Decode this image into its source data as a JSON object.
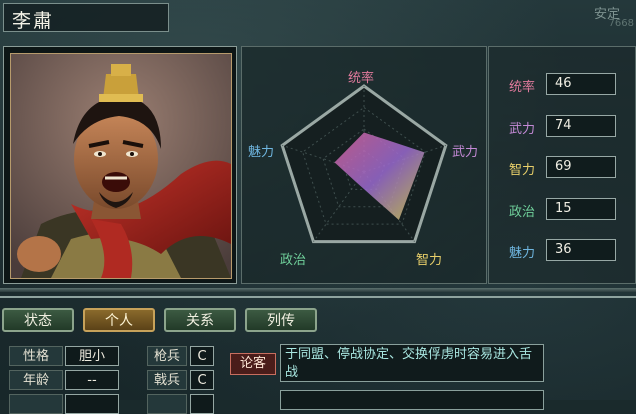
{
  "character": {
    "name": "李肅"
  },
  "corner": {
    "status": "安定",
    "sub": "7668"
  },
  "radar": {
    "labels": {
      "command": "统率",
      "war": "武力",
      "intel": "智力",
      "politics": "政治",
      "charm": "魅力"
    },
    "values": {
      "command": 46,
      "war": 74,
      "intel": 69,
      "politics": 15,
      "charm": 36
    },
    "max": 100
  },
  "stats": [
    {
      "label": "统率",
      "value": "46",
      "color": "#e07a9c"
    },
    {
      "label": "武力",
      "value": "74",
      "color": "#c48ad6"
    },
    {
      "label": "智力",
      "value": "69",
      "color": "#e8cf6a"
    },
    {
      "label": "政治",
      "value": "15",
      "color": "#6fcf9a"
    },
    {
      "label": "魅力",
      "value": "36",
      "color": "#6fb6e0"
    }
  ],
  "tabs": [
    {
      "label": "状态",
      "active": false
    },
    {
      "label": "个人",
      "active": true
    },
    {
      "label": "关系",
      "active": false
    },
    {
      "label": "列传",
      "active": false
    }
  ],
  "personal": {
    "personality_label": "性格",
    "personality_value": "胆小",
    "age_label": "年龄",
    "age_value": "--"
  },
  "aptitude": {
    "spear_label": "枪兵",
    "spear_value": "C",
    "halberd_label": "戟兵",
    "halberd_value": "C"
  },
  "skill": {
    "name": "论客",
    "description": "于同盟、停战协定、交换俘虏时容易进入舌战"
  },
  "colors": {
    "command": "#e07a9c",
    "war": "#c48ad6",
    "intel": "#e8cf6a",
    "politics": "#6fcf9a",
    "charm": "#6fb6e0",
    "accent": "#c7a25a"
  }
}
